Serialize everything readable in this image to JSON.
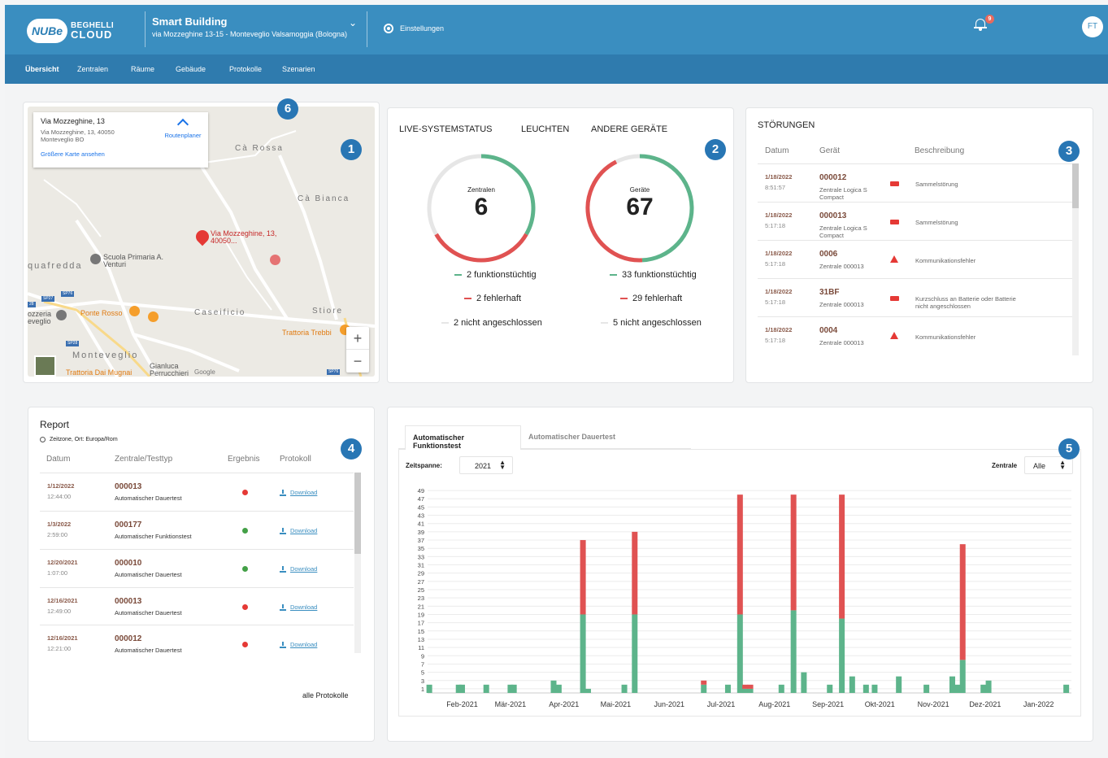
{
  "brand": {
    "logo_mark": "NUBe",
    "logo_line1": "BEGHELLI",
    "logo_line2": "CLOUD"
  },
  "building": {
    "name": "Smart Building",
    "address": "via Mozzeghine 13-15 - Monteveglio Valsamoggia (Bologna)"
  },
  "header": {
    "settings_label": "Einstellungen",
    "notification_count": "9",
    "user_initials": "FT"
  },
  "nav": [
    {
      "label": "Übersicht",
      "active": true
    },
    {
      "label": "Zentralen"
    },
    {
      "label": "Räume"
    },
    {
      "label": "Gebäude"
    },
    {
      "label": "Protokolle"
    },
    {
      "label": "Szenarien"
    }
  ],
  "markers": [
    "1",
    "2",
    "3",
    "4",
    "5",
    "6"
  ],
  "map": {
    "info_title": "Via Mozzeghine, 13",
    "info_address": "Via Mozzeghine, 13, 40050 Monteveglio BO",
    "info_link": "Größere Karte ansehen",
    "route_label": "Routenplaner",
    "place_labels": [
      "Cà Rossa",
      "Cà Bianca",
      "quafredda",
      "Caseificio",
      "Stiore",
      "Monteveglio",
      "ozzeria",
      "eveglio"
    ],
    "poi_labels": [
      "Via Mozzeghine, 13, 40050...",
      "Scuola Primaria A. Venturi",
      "Ponte Rosso",
      "Trattoria Trebbi",
      "Trattoria Dai Mugnai",
      "Gianluca Perrucchieri Monteveglio"
    ],
    "road_shields": [
      "SP27",
      "SP76",
      "SP28",
      "SP76",
      "28"
    ],
    "zoom_in": "+",
    "zoom_out": "−",
    "map_attribution": "Google"
  },
  "system_status": {
    "tabs": [
      "LIVE-SYSTEMSTATUS",
      "LEUCHTEN",
      "ANDERE GERÄTE"
    ],
    "central": {
      "label": "Zentralen",
      "value": "6",
      "ok": 2,
      "fault": 2,
      "disconnected": 2,
      "ok_text": "2 funktionstüchtig",
      "fault_text": "2 fehlerhaft",
      "disc_text": "2 nicht angeschlossen"
    },
    "devices": {
      "label": "Geräte",
      "value": "67",
      "ok": 33,
      "fault": 29,
      "disconnected": 5,
      "ok_text": "33 funktionstüchtig",
      "fault_text": "29 fehlerhaft",
      "disc_text": "5 nicht angeschlossen"
    },
    "colors": {
      "ok": "#5db48b",
      "fault": "#e05252",
      "disconnected": "#e6e6e6"
    }
  },
  "faults": {
    "title": "STÖRUNGEN",
    "columns": [
      "Datum",
      "Gerät",
      "Beschreibung"
    ],
    "rows": [
      {
        "date": "1/18/2022",
        "time": "8:51:57",
        "device": "000012",
        "device_sub": "Zentrale Logica S Compact",
        "icon": "battery-icon",
        "desc": "Sammelstörung"
      },
      {
        "date": "1/18/2022",
        "time": "5:17:18",
        "device": "000013",
        "device_sub": "Zentrale Logica S Compact",
        "icon": "battery-icon",
        "desc": "Sammelstörung"
      },
      {
        "date": "1/18/2022",
        "time": "5:17:18",
        "device": "0006",
        "device_sub": "Zentrale 000013",
        "icon": "warning-icon",
        "desc": "Kommunikationsfehler"
      },
      {
        "date": "1/18/2022",
        "time": "5:17:18",
        "device": "31BF",
        "device_sub": "Zentrale 000013",
        "icon": "battery-icon",
        "desc": "Kurzschluss an Batterie oder Batterie nicht angeschlossen"
      },
      {
        "date": "1/18/2022",
        "time": "5:17:18",
        "device": "0004",
        "device_sub": "Zentrale 000013",
        "icon": "warning-icon",
        "desc": "Kommunikationsfehler"
      }
    ]
  },
  "report": {
    "title": "Report",
    "timezone": "Zeitzone, Ort: Europa/Rom",
    "columns": [
      "Datum",
      "Zentrale/Testtyp",
      "Ergebnis",
      "Protokoll"
    ],
    "rows": [
      {
        "date": "1/12/2022",
        "time": "12:44:00",
        "central": "000013",
        "type": "Automatischer Dauertest",
        "result": "fail",
        "link": "Download"
      },
      {
        "date": "1/3/2022",
        "time": "2:59:00",
        "central": "000177",
        "type": "Automatischer Funktionstest",
        "result": "ok",
        "link": "Download"
      },
      {
        "date": "12/20/2021",
        "time": "1:07:00",
        "central": "000010",
        "type": "Automatischer Dauertest",
        "result": "ok",
        "link": "Download"
      },
      {
        "date": "12/16/2021",
        "time": "12:49:00",
        "central": "000013",
        "type": "Automatischer Dauertest",
        "result": "fail",
        "link": "Download"
      },
      {
        "date": "12/16/2021",
        "time": "12:21:00",
        "central": "000012",
        "type": "Automatischer Dauertest",
        "result": "fail",
        "link": "Download"
      }
    ],
    "all_link": "alle Protokolle"
  },
  "tests": {
    "tabs": [
      "Automatischer Funktionstest",
      "Automatischer Dauertest"
    ],
    "period_label": "Zeitspanne:",
    "period_value": "2021",
    "central_label": "Zentrale",
    "central_value": "Alle"
  },
  "chart_data": {
    "type": "bar",
    "stacked": true,
    "x_type": "date",
    "xlabel": "",
    "ylabel": "",
    "ylim": [
      0,
      50
    ],
    "y_ticks": [
      1,
      3,
      5,
      7,
      9,
      11,
      13,
      15,
      17,
      19,
      21,
      23,
      25,
      27,
      29,
      31,
      33,
      35,
      37,
      39,
      41,
      43,
      45,
      47,
      49
    ],
    "x_tick_labels": [
      "Feb-2021",
      "Mär-2021",
      "Apr-2021",
      "Mai-2021",
      "Jun-2021",
      "Jul-2021",
      "Aug-2021",
      "Sep-2021",
      "Okt-2021",
      "Nov-2021",
      "Dez-2021",
      "Jan-2022"
    ],
    "x_tick_dates": [
      "2021-02-01",
      "2021-03-01",
      "2021-04-01",
      "2021-05-01",
      "2021-06-01",
      "2021-07-01",
      "2021-08-01",
      "2021-09-01",
      "2021-10-01",
      "2021-11-01",
      "2021-12-01",
      "2022-01-01"
    ],
    "x_range": [
      "2021-01-12",
      "2022-01-20"
    ],
    "series_colors": {
      "ok": "#5db48b",
      "fail": "#e05252"
    },
    "bars": [
      {
        "date": "2021-01-13",
        "ok": 2,
        "fail": 0
      },
      {
        "date": "2021-01-30",
        "ok": 2,
        "fail": 0
      },
      {
        "date": "2021-02-01",
        "ok": 2,
        "fail": 0
      },
      {
        "date": "2021-02-15",
        "ok": 2,
        "fail": 0
      },
      {
        "date": "2021-03-01",
        "ok": 2,
        "fail": 0
      },
      {
        "date": "2021-03-03",
        "ok": 2,
        "fail": 0
      },
      {
        "date": "2021-03-26",
        "ok": 3,
        "fail": 0
      },
      {
        "date": "2021-03-29",
        "ok": 2,
        "fail": 0
      },
      {
        "date": "2021-04-12",
        "ok": 19,
        "fail": 18
      },
      {
        "date": "2021-04-15",
        "ok": 1,
        "fail": 0
      },
      {
        "date": "2021-05-06",
        "ok": 2,
        "fail": 0
      },
      {
        "date": "2021-05-12",
        "ok": 19,
        "fail": 20
      },
      {
        "date": "2021-06-21",
        "ok": 2,
        "fail": 1
      },
      {
        "date": "2021-07-05",
        "ok": 2,
        "fail": 0
      },
      {
        "date": "2021-07-12",
        "ok": 19,
        "fail": 29
      },
      {
        "date": "2021-07-15",
        "ok": 1,
        "fail": 1
      },
      {
        "date": "2021-07-18",
        "ok": 1,
        "fail": 1
      },
      {
        "date": "2021-08-05",
        "ok": 2,
        "fail": 0
      },
      {
        "date": "2021-08-12",
        "ok": 20,
        "fail": 28
      },
      {
        "date": "2021-08-18",
        "ok": 5,
        "fail": 0
      },
      {
        "date": "2021-09-02",
        "ok": 2,
        "fail": 0
      },
      {
        "date": "2021-09-09",
        "ok": 18,
        "fail": 30
      },
      {
        "date": "2021-09-15",
        "ok": 4,
        "fail": 0
      },
      {
        "date": "2021-09-23",
        "ok": 2,
        "fail": 0
      },
      {
        "date": "2021-09-28",
        "ok": 2,
        "fail": 0
      },
      {
        "date": "2021-10-12",
        "ok": 4,
        "fail": 0
      },
      {
        "date": "2021-10-28",
        "ok": 2,
        "fail": 0
      },
      {
        "date": "2021-11-12",
        "ok": 4,
        "fail": 0
      },
      {
        "date": "2021-11-15",
        "ok": 2,
        "fail": 0
      },
      {
        "date": "2021-11-18",
        "ok": 8,
        "fail": 28
      },
      {
        "date": "2021-11-30",
        "ok": 2,
        "fail": 0
      },
      {
        "date": "2021-12-03",
        "ok": 3,
        "fail": 0
      },
      {
        "date": "2022-01-17",
        "ok": 2,
        "fail": 0
      }
    ]
  }
}
